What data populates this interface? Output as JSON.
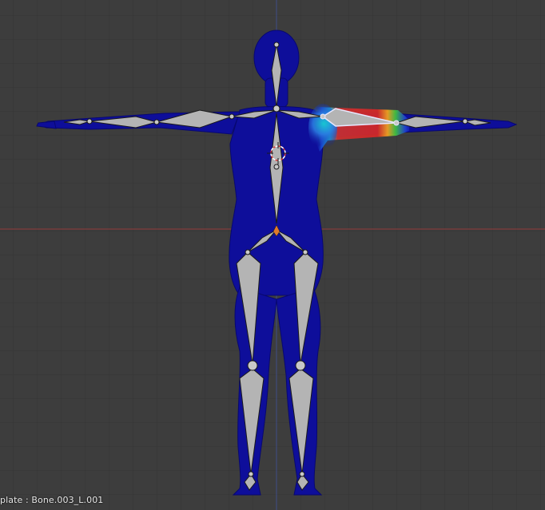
{
  "viewport": {
    "status_text": "plate : Bone.003_L.001"
  },
  "scene": {
    "mode": "weight-paint",
    "active_bone": "Bone.003_L.001",
    "colors": {
      "background": "#3d3d3d",
      "grid_line": "#353535",
      "x_axis": "#923c3c",
      "y_axis": "#3f4d87",
      "mesh_low_weight": "#0e0e9a",
      "bone_fill": "#b4b4b4",
      "bone_selected_outline": "#e8e8ff",
      "joint_highlight": "#e07a2a",
      "cursor_red": "#d23a3a"
    }
  }
}
